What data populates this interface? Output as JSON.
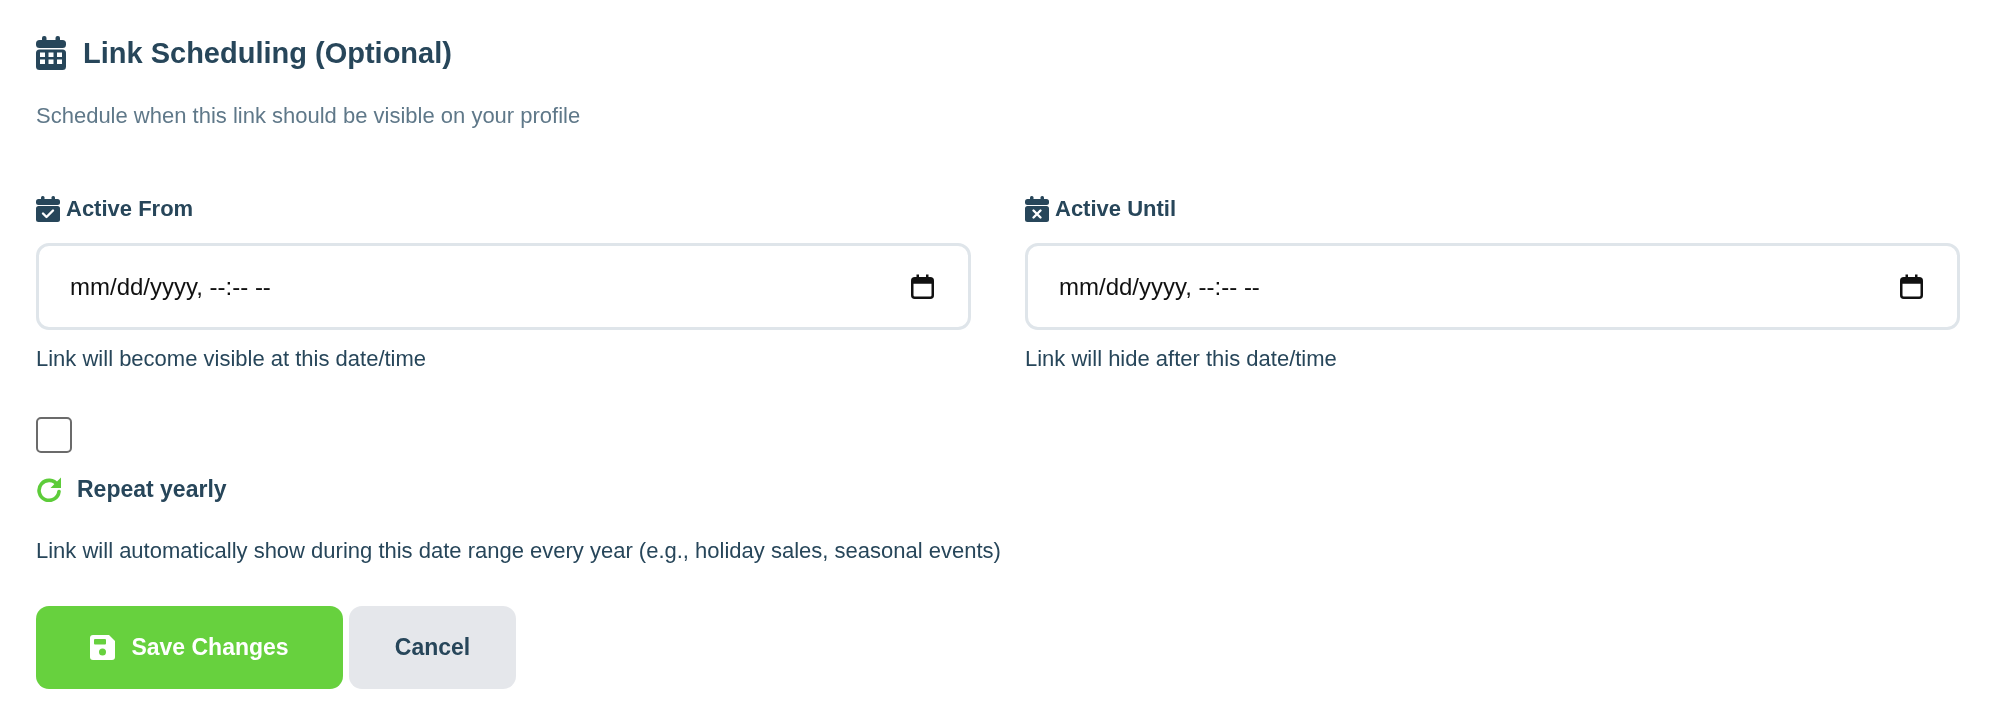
{
  "section": {
    "title": "Link Scheduling (Optional)",
    "subtitle": "Schedule when this link should be visible on your profile"
  },
  "fields": [
    {
      "kind": "start",
      "label": "Active From",
      "placeholder": "mm/dd/yyyy, --:-- --",
      "hint": "Link will become visible at this date/time"
    },
    {
      "kind": "end",
      "label": "Active Until",
      "placeholder": "mm/dd/yyyy, --:-- --",
      "hint": "Link will hide after this date/time"
    }
  ],
  "repeat": {
    "checked": false,
    "label": "Repeat yearly",
    "description": "Link will automatically show during this date range every year (e.g., holiday sales, seasonal events)"
  },
  "buttons": [
    {
      "kind": "primary",
      "label": "Save Changes"
    },
    {
      "kind": "secondary",
      "label": "Cancel"
    }
  ]
}
